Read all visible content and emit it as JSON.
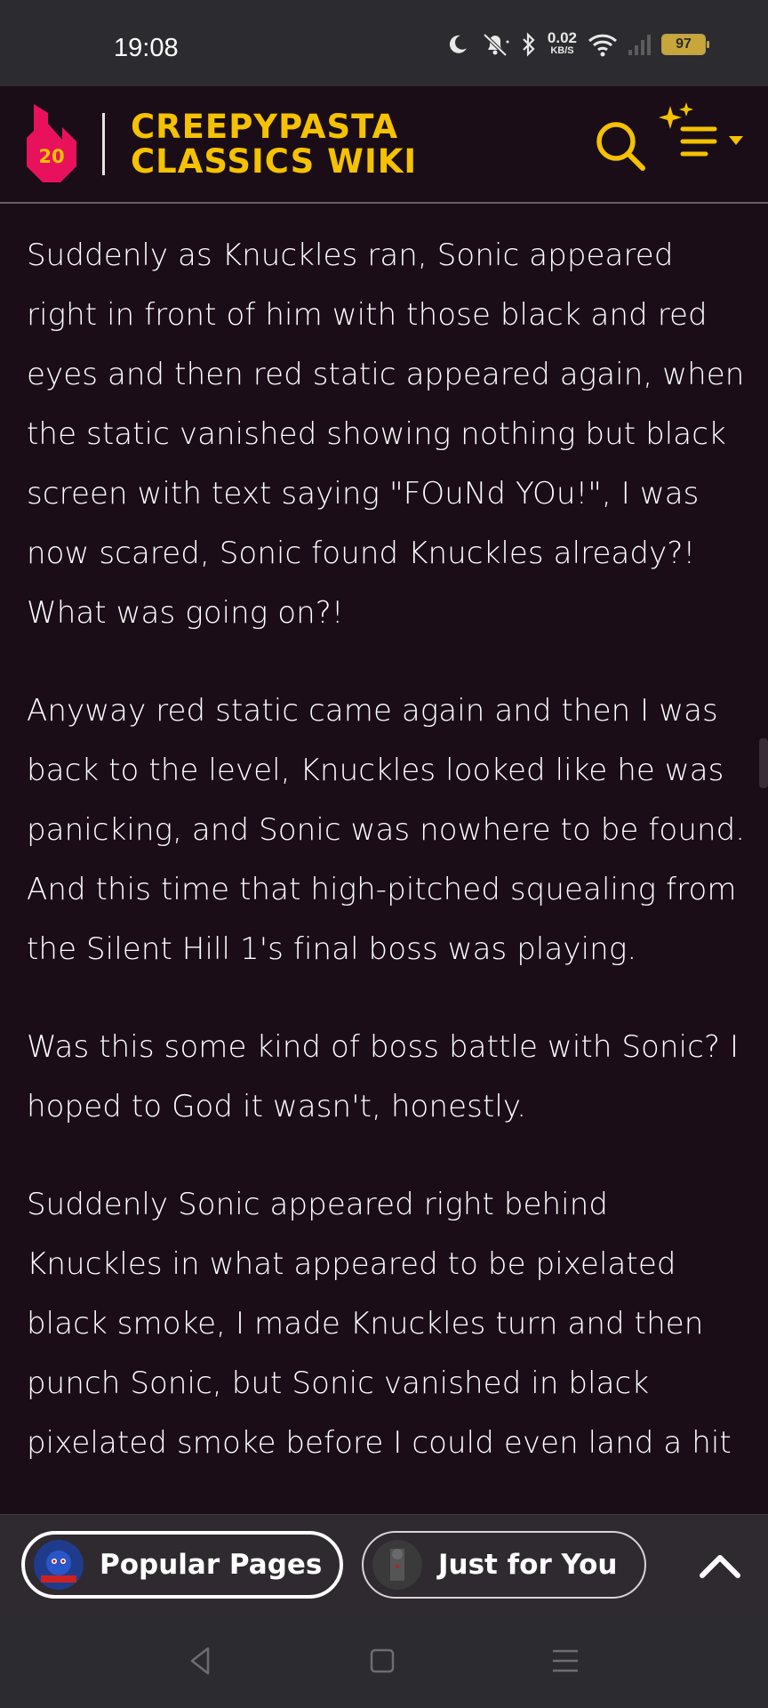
{
  "status_bar": {
    "time": "19:08",
    "net_speed_value": "0.02",
    "net_speed_unit": "KB/S",
    "battery": "97",
    "icons": [
      "moon-icon",
      "bell-muted-icon",
      "bluetooth-icon",
      "wifi-icon",
      "signal-icon",
      "battery-icon"
    ]
  },
  "header": {
    "logo_badge": "20",
    "title_line1": "CREEPYPASTA",
    "title_line2": "CLASSICS WIKI",
    "accent_color": "#f4c200",
    "logo_color": "#e8125c"
  },
  "article": {
    "paragraphs": [
      "Suddenly as Knuckles ran, Sonic appeared right in front of him with those black and red eyes and then red static appeared again, when the static vanished showing nothing but black screen with text saying \"FOuNd YOu!\", I was now scared, Sonic found Knuckles already?! What was going on?!",
      "Anyway red static came again and then I was back to the level, Knuckles looked like he was panicking, and Sonic was nowhere to be found. And this time that high-pitched squealing from the Silent Hill 1's final boss was playing.",
      "Was this some kind of boss battle with Sonic? I hoped to God it wasn't, honestly.",
      "Suddenly Sonic appeared right behind Knuckles in what appeared to be pixelated black smoke, I made Knuckles turn and then punch Sonic, but Sonic vanished in black pixelated smoke before I could even land a hit"
    ]
  },
  "bottom_bar": {
    "popular_label": "Popular Pages",
    "for_you_label": "Just for You"
  }
}
